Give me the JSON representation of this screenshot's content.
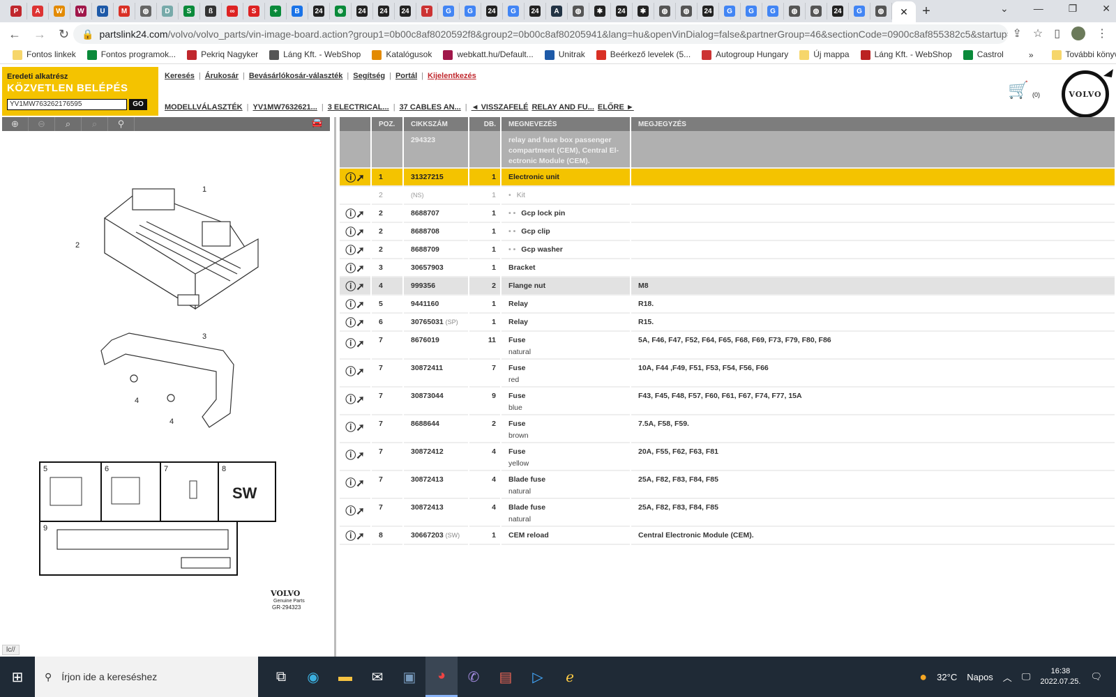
{
  "browser": {
    "tabs": [
      {
        "icon": "pekriq-icon",
        "color": "#c0272d",
        "label": "P"
      },
      {
        "icon": "alert-icon",
        "color": "#d33",
        "label": "A"
      },
      {
        "icon": "katalogus-icon",
        "color": "#e38a00",
        "label": "W"
      },
      {
        "icon": "webkatt-icon",
        "color": "#a0174a",
        "label": "W"
      },
      {
        "icon": "unitrak-icon",
        "color": "#1e5aa8",
        "label": "U"
      },
      {
        "icon": "gmail-icon",
        "color": "#d93025",
        "label": "M"
      },
      {
        "icon": "globe-icon",
        "color": "#666",
        "label": "◍"
      },
      {
        "icon": "doc-icon",
        "color": "#7aa",
        "label": "D"
      },
      {
        "icon": "sheet-icon",
        "color": "#0a8a3a",
        "label": "S"
      },
      {
        "icon": "script-icon",
        "color": "#333",
        "label": "ß"
      },
      {
        "icon": "link-icon",
        "color": "#d22",
        "label": "∞"
      },
      {
        "icon": "shop-icon",
        "color": "#d22",
        "label": "S"
      },
      {
        "icon": "plus-icon",
        "color": "#0a8a3a",
        "label": "+"
      },
      {
        "icon": "blue-icon",
        "color": "#1a73e8",
        "label": "B"
      },
      {
        "icon": "partslink-icon",
        "color": "#222",
        "label": "24"
      },
      {
        "icon": "green-icon",
        "color": "#0a8a3a",
        "label": "⊕"
      },
      {
        "icon": "partslink-icon",
        "color": "#222",
        "label": "24"
      },
      {
        "icon": "partslink-icon",
        "color": "#222",
        "label": "24"
      },
      {
        "icon": "partslink-icon",
        "color": "#222",
        "label": "24"
      },
      {
        "icon": "t-icon",
        "color": "#c33",
        "label": "T"
      },
      {
        "icon": "google-icon",
        "color": "#4285f4",
        "label": "G"
      },
      {
        "icon": "google-icon",
        "color": "#4285f4",
        "label": "G"
      },
      {
        "icon": "partslink-icon",
        "color": "#222",
        "label": "24"
      },
      {
        "icon": "google-icon",
        "color": "#4285f4",
        "label": "G"
      },
      {
        "icon": "partslink-icon",
        "color": "#222",
        "label": "24"
      },
      {
        "icon": "a-icon",
        "color": "#234",
        "label": "A"
      },
      {
        "icon": "globe-icon",
        "color": "#555",
        "label": "◍"
      },
      {
        "icon": "mercedes-icon",
        "color": "#222",
        "label": "✱"
      },
      {
        "icon": "partslink-icon",
        "color": "#222",
        "label": "24"
      },
      {
        "icon": "mercedes-icon",
        "color": "#222",
        "label": "✱"
      },
      {
        "icon": "globe-icon",
        "color": "#555",
        "label": "◍"
      },
      {
        "icon": "globe-icon",
        "color": "#555",
        "label": "◍"
      },
      {
        "icon": "partslink-icon",
        "color": "#222",
        "label": "24"
      },
      {
        "icon": "google-icon",
        "color": "#4285f4",
        "label": "G"
      },
      {
        "icon": "google-icon",
        "color": "#4285f4",
        "label": "G"
      },
      {
        "icon": "google-icon",
        "color": "#4285f4",
        "label": "G"
      },
      {
        "icon": "globe-icon",
        "color": "#555",
        "label": "◍"
      },
      {
        "icon": "globe-icon",
        "color": "#555",
        "label": "◍"
      },
      {
        "icon": "partslink-icon",
        "color": "#222",
        "label": "24"
      },
      {
        "icon": "google-icon",
        "color": "#4285f4",
        "label": "G"
      },
      {
        "icon": "globe-icon",
        "color": "#555",
        "label": "◍"
      }
    ],
    "url_host": "partslink24.com",
    "url_path": "/volvo/volvo_parts/vin-image-board.action?group1=0b00c8af8020592f8&group2=0b00c8af80205941&lang=hu&openVinDialog=false&partnerGroup=46&sectionCode=0900c8af855382c5&startup=false...",
    "bookmarks": [
      {
        "label": "Fontos linkek",
        "color": "#f6d66b"
      },
      {
        "label": "Fontos programok...",
        "color": "#0a8a3a"
      },
      {
        "label": "Pekriq Nagyker",
        "color": "#c0272d"
      },
      {
        "label": "Láng Kft. - WebShop",
        "color": "#555"
      },
      {
        "label": "Katalógusok",
        "color": "#e38a00"
      },
      {
        "label": "webkatt.hu/Default...",
        "color": "#a0174a"
      },
      {
        "label": "Unitrak",
        "color": "#1e5aa8"
      },
      {
        "label": "Beérkező levelek (5...",
        "color": "#d93025"
      },
      {
        "label": "Autogroup Hungary",
        "color": "#c33"
      },
      {
        "label": "Új mappa",
        "color": "#f6d66b"
      },
      {
        "label": "Láng Kft. - WebShop",
        "color": "#b22"
      },
      {
        "label": "Castrol",
        "color": "#0a8a3a"
      }
    ],
    "bookmarks_more": "»",
    "other_bookmarks": "További könyvjelzők"
  },
  "header": {
    "title_small": "Eredeti alkatrész",
    "title_big": "KÖZVETLEN BELÉPÉS",
    "vin": "YV1MW763262176595",
    "go": "GO",
    "nav": [
      "Keresés",
      "Árukosár",
      "Bevásárlókosár-választék",
      "Segítség",
      "Portál",
      "Kijelentkezés"
    ],
    "crumbs": [
      "MODELLVÁLASZTÉK",
      "YV1MW7632621...",
      "3 ELECTRICAL...",
      "37 CABLES AN...",
      "◄ VISSZAFELÉ",
      "RELAY AND FU...",
      "ELŐRE ►"
    ],
    "cart_count": "(0)",
    "logo": "VOLVO"
  },
  "diagram": {
    "callouts": [
      "1",
      "2",
      "3",
      "4",
      "4",
      "5",
      "6",
      "7",
      "8",
      "9"
    ],
    "sw": "SW",
    "brand": "VOLVO",
    "brand_sub": "Genuine Parts",
    "ref": "GR-294323",
    "status": "lc//"
  },
  "table": {
    "headers": [
      "POZ.",
      "CIKKSZÁM",
      "DB.",
      "MEGNEVEZÉS",
      "MEGJEGYZÉS"
    ],
    "group": {
      "part": "294323",
      "name": "relay and fuse box passenger compartment (CEM), Central El-ectronic Module (CEM)."
    },
    "rows": [
      {
        "pos": "1",
        "part": "31327215",
        "qty": "1",
        "name": "Electronic unit",
        "note": "",
        "state": "selected"
      },
      {
        "pos": "2",
        "part": "(NS)",
        "qty": "1",
        "name": "Kit",
        "note": "",
        "indent": "•",
        "state": "ns"
      },
      {
        "pos": "2",
        "part": "8688707",
        "qty": "1",
        "name": "Gcp lock pin",
        "note": "",
        "indent": "•  •"
      },
      {
        "pos": "2",
        "part": "8688708",
        "qty": "1",
        "name": "Gcp clip",
        "note": "",
        "indent": "•  •"
      },
      {
        "pos": "2",
        "part": "8688709",
        "qty": "1",
        "name": "Gcp washer",
        "note": "",
        "indent": "•  •"
      },
      {
        "pos": "3",
        "part": "30657903",
        "qty": "1",
        "name": "Bracket",
        "note": ""
      },
      {
        "pos": "4",
        "part": "999356",
        "qty": "2",
        "name": "Flange nut",
        "note": "M8",
        "state": "gray"
      },
      {
        "pos": "5",
        "part": "9441160",
        "qty": "1",
        "name": "Relay",
        "note": "R18."
      },
      {
        "pos": "6",
        "part": "30765031",
        "tag": "(SP)",
        "qty": "1",
        "name": "Relay",
        "note": "R15."
      },
      {
        "pos": "7",
        "part": "8676019",
        "qty": "11",
        "name": "Fuse",
        "sub": "natural",
        "note": "5A, F46, F47, F52, F64, F65, F68, F69, F73, F79, F80, F86"
      },
      {
        "pos": "7",
        "part": "30872411",
        "qty": "7",
        "name": "Fuse",
        "sub": "red",
        "note": "10A, F44 ,F49, F51, F53, F54, F56, F66"
      },
      {
        "pos": "7",
        "part": "30873044",
        "qty": "9",
        "name": "Fuse",
        "sub": "blue",
        "note": "F43, F45, F48, F57, F60, F61, F67, F74, F77, 15A"
      },
      {
        "pos": "7",
        "part": "8688644",
        "qty": "2",
        "name": "Fuse",
        "sub": "brown",
        "note": "7.5A, F58, F59."
      },
      {
        "pos": "7",
        "part": "30872412",
        "qty": "4",
        "name": "Fuse",
        "sub": "yellow",
        "note": "20A, F55, F62, F63, F81"
      },
      {
        "pos": "7",
        "part": "30872413",
        "qty": "4",
        "name": "Blade fuse",
        "sub": "natural",
        "note": "25A, F82, F83, F84, F85"
      },
      {
        "pos": "7",
        "part": "30872413",
        "qty": "4",
        "name": "Blade fuse",
        "sub": "natural",
        "note": "25A, F82, F83, F84, F85"
      },
      {
        "pos": "8",
        "part": "30667203",
        "tag": "(SW)",
        "qty": "1",
        "name": "CEM reload",
        "note": "Central Electronic Module (CEM)."
      }
    ]
  },
  "taskbar": {
    "search_placeholder": "Írjon ide a kereséshez",
    "weather": "32°C",
    "weather_desc": "Napos",
    "time": "16:38",
    "date": "2022.07.25."
  },
  "colors": {
    "accent": "#f4c300",
    "header_gray": "#7d7d7d",
    "taskbar": "#1f2a36"
  }
}
